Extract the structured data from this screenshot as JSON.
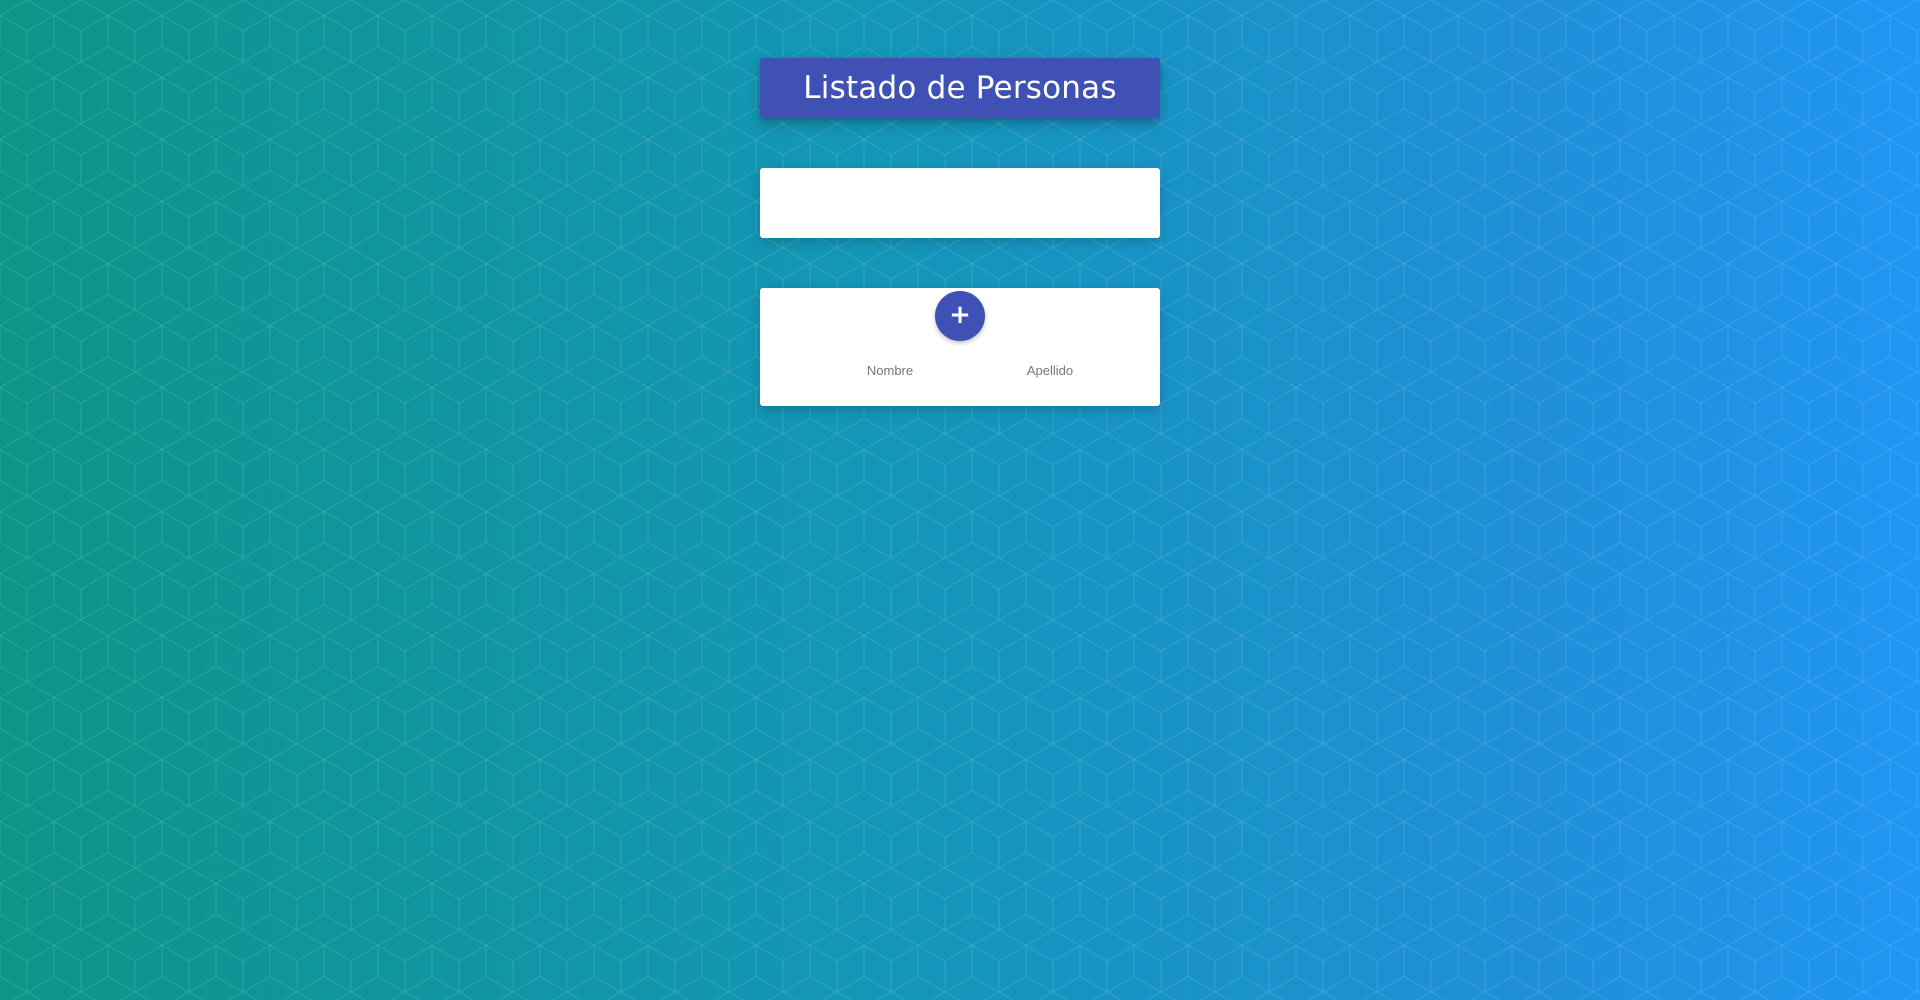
{
  "page": {
    "title": "Listado de Personas",
    "background_colors": [
      "#0e9488",
      "#2196f3"
    ],
    "accent_color": "#3f51b5"
  },
  "search": {
    "value": "",
    "placeholder": ""
  },
  "table": {
    "add_button": {
      "label": "+",
      "icon": "plus-icon"
    },
    "columns": [
      "Nombre",
      "Apellido"
    ],
    "rows": []
  }
}
